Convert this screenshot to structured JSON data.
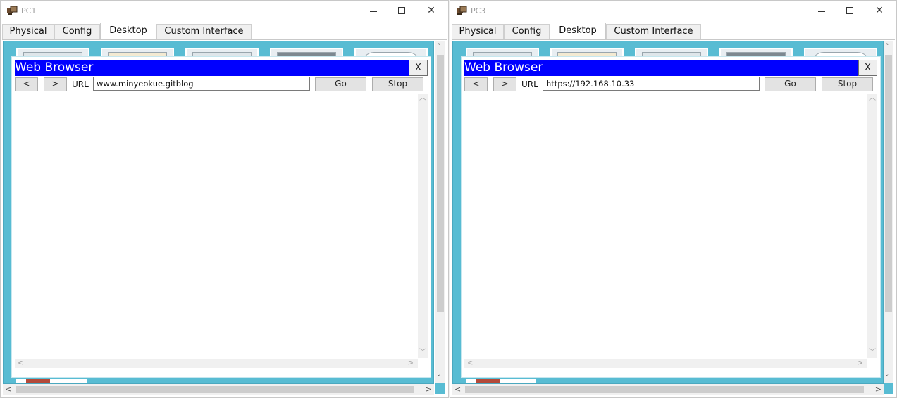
{
  "windows": [
    {
      "title": "PC1",
      "tabs": [
        "Physical",
        "Config",
        "Desktop",
        "Custom Interface"
      ],
      "active_tab": "Desktop",
      "browser": {
        "title": "Web Browser",
        "close_label": "X",
        "back_label": "<",
        "forward_label": ">",
        "url_label": "URL",
        "url_value": "www.minyeokue.gitblog",
        "go_label": "Go",
        "stop_label": "Stop"
      }
    },
    {
      "title": "PC3",
      "tabs": [
        "Physical",
        "Config",
        "Desktop",
        "Custom Interface"
      ],
      "active_tab": "Desktop",
      "browser": {
        "title": "Web Browser",
        "close_label": "X",
        "back_label": "<",
        "forward_label": ">",
        "url_label": "URL",
        "url_value": "https://192.168.10.33",
        "go_label": "Go",
        "stop_label": "Stop"
      }
    }
  ],
  "icons": {
    "app": "pc-device-icon",
    "minimize": "minimize-icon",
    "maximize": "maximize-icon",
    "close": "close-icon"
  },
  "colors": {
    "desktop_bg": "#58bcd3",
    "browser_titlebar": "#0000ff"
  }
}
